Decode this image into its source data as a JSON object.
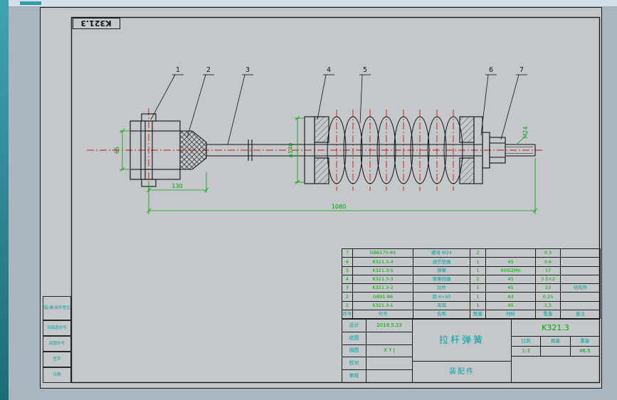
{
  "sheet": {
    "corner_label": "K321.3"
  },
  "drawing": {
    "callouts": [
      "1",
      "2",
      "3",
      "4",
      "5",
      "6",
      "7"
    ],
    "dims": {
      "clevis_height": "65",
      "clevis_length": "130",
      "overall_length": "1080",
      "seat_diameter": "φ140",
      "end_thread": "M24"
    }
  },
  "bom": {
    "headers": {
      "no": "序号",
      "code": "代号",
      "name": "名称",
      "qty": "数量",
      "mat": "材料",
      "wt": "重量",
      "note": "备注"
    },
    "rows": [
      {
        "no": "7",
        "code": "GB6170-85",
        "name": "螺母 M24",
        "qty": "2",
        "mat": "",
        "wt": "0.3",
        "note": ""
      },
      {
        "no": "6",
        "code": "K321.3-4",
        "name": "调节垫圈",
        "qty": "1",
        "mat": "45",
        "wt": "0.6",
        "note": ""
      },
      {
        "no": "5",
        "code": "K321.3-5",
        "name": "弹簧",
        "qty": "1",
        "mat": "60Si2Mn",
        "wt": "17",
        "note": ""
      },
      {
        "no": "4",
        "code": "K321.3-3",
        "name": "弹簧挡圈",
        "qty": "2",
        "mat": "45",
        "wt": "3.5×2",
        "note": ""
      },
      {
        "no": "3",
        "code": "K321.3-2",
        "name": "拉杆",
        "qty": "1",
        "mat": "45",
        "wt": "23",
        "note": "结构件"
      },
      {
        "no": "2",
        "code": "GB91-86",
        "name": "销 6×60",
        "qty": "1",
        "mat": "A3",
        "wt": "0.25",
        "note": ""
      },
      {
        "no": "1",
        "code": "K321.3-1",
        "name": "吊耳",
        "qty": "1",
        "mat": "45",
        "wt": "1.5",
        "note": ""
      }
    ]
  },
  "title_block": {
    "rows": [
      {
        "label": "设计",
        "value": "2019.5.23"
      },
      {
        "label": "绘图",
        "value": ""
      },
      {
        "label": "描图",
        "value": "X Y J"
      },
      {
        "label": "校对",
        "value": ""
      },
      {
        "label": "审核",
        "value": ""
      }
    ],
    "title": "拉杆弹簧",
    "subtitle": "装配件",
    "drawing_no": "K321.3",
    "scale_label": "比例",
    "qty_label": "数量",
    "weight_label": "重量",
    "scale": "1:3",
    "qty": "",
    "weight": "46.5"
  },
  "margin_blocks": [
    "借(通)用件登记",
    "旧底图总号",
    "底图总号",
    "签字",
    "日期"
  ]
}
